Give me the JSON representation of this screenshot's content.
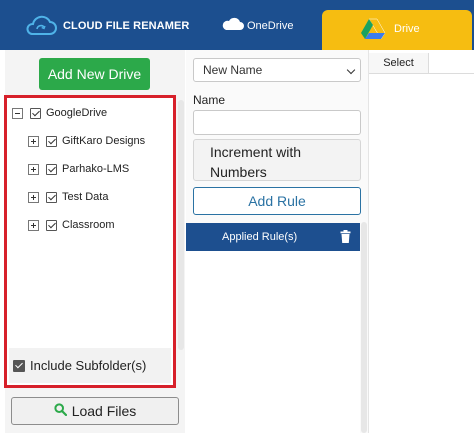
{
  "header": {
    "app_title": "CLOUD FILE RENAMER",
    "logo_icon": "cloud-refresh-icon",
    "onedrive_label": "OneDrive",
    "onedrive_icon": "cloud-icon",
    "drive_tab_label": "Drive",
    "drive_icon": "google-drive-icon",
    "colors": {
      "header_bg": "#1c4f8f",
      "active_tab_bg": "#f6bd11"
    }
  },
  "left": {
    "add_drive_label": "Add New Drive",
    "tree": {
      "root": {
        "label": "GoogleDrive",
        "checked": true,
        "expanded": true
      },
      "children": [
        {
          "label": "GiftKaro Designs",
          "checked": true,
          "expanded": false
        },
        {
          "label": "Parhako-LMS",
          "checked": true,
          "expanded": false
        },
        {
          "label": "Test Data",
          "checked": true,
          "expanded": false
        },
        {
          "label": "Classroom",
          "checked": true,
          "expanded": false
        }
      ]
    },
    "include_subfolders_label": "Include Subfolder(s)",
    "include_subfolders_checked": true,
    "load_files_label": "Load Files",
    "load_icon": "search-icon",
    "highlight_color": "#d7202a"
  },
  "middle": {
    "rule_select_value": "New Name",
    "name_label": "Name",
    "name_value": "",
    "increment_label": "Increment with Numbers",
    "add_rule_label": "Add Rule",
    "applied_rules_label": "Applied Rule(s)",
    "trash_icon": "trash-icon"
  },
  "right": {
    "select_header": "Select"
  }
}
